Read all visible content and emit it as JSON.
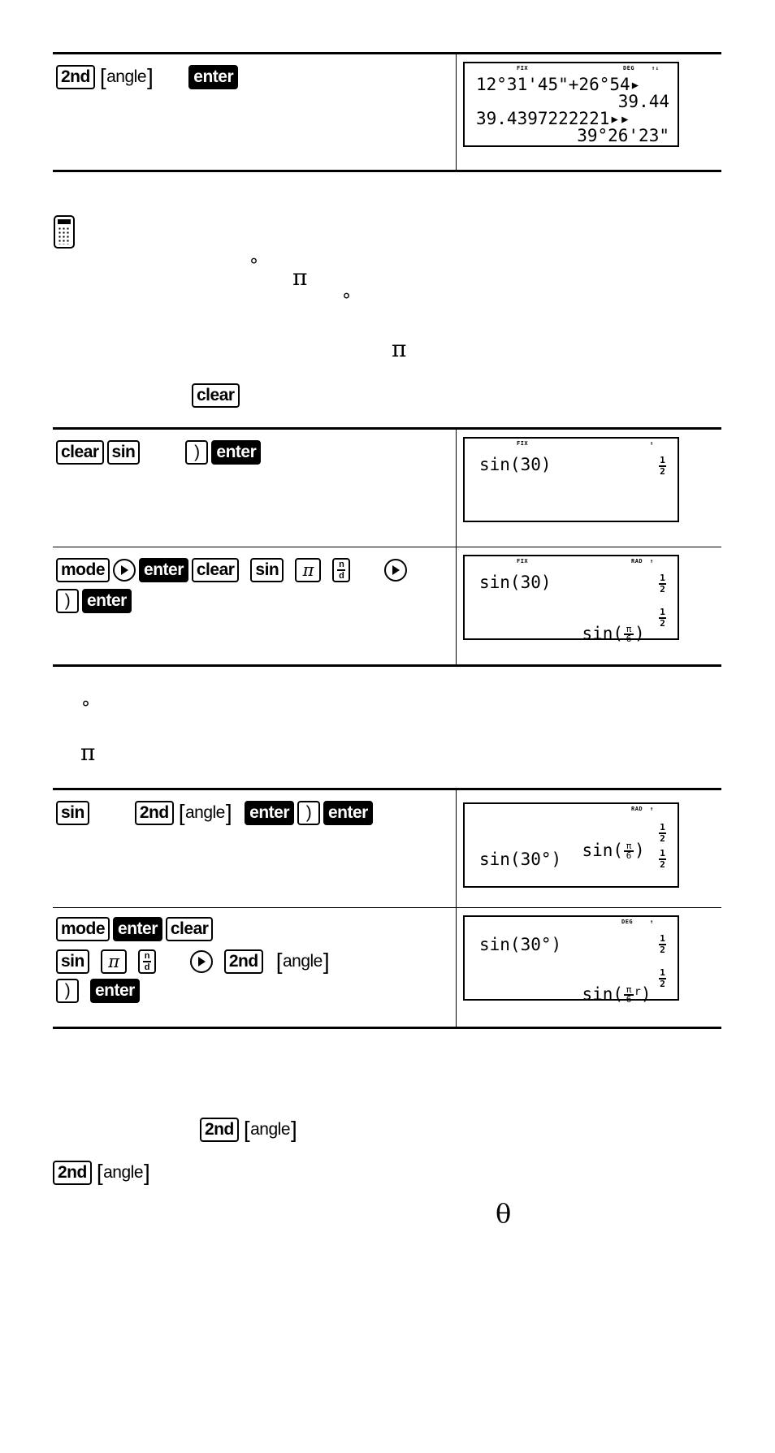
{
  "table1": {
    "row1": {
      "keys": [
        "2nd",
        "angle",
        "enter"
      ],
      "screen": {
        "indicators": {
          "left": "FIX",
          "mode": "DEG",
          "arrows": "↑↓"
        },
        "lines": [
          "12°31'45\"+26°54▸",
          "39.44",
          "39.4397222221▸▸",
          "39°26'23\""
        ]
      }
    }
  },
  "note_icon": "calculator-icon",
  "prose": {
    "degree1": "°",
    "pi1": "π",
    "degree2": "°",
    "pi2": "π",
    "clear_key": "clear"
  },
  "table2": {
    "row1": {
      "keys": [
        "clear",
        "sin",
        ")",
        "enter"
      ],
      "screen": {
        "indicators": {
          "left": "FIX",
          "arrows": "↑"
        },
        "lines": [
          "sin(30)"
        ],
        "results": [
          {
            "num": "1",
            "den": "2"
          }
        ]
      }
    },
    "row2": {
      "keys": [
        "mode",
        "right-arrow",
        "enter",
        "clear",
        "sin",
        "π",
        "n/d",
        "right-arrow",
        ")",
        "enter"
      ],
      "frac_key": {
        "num": "n",
        "den": "d"
      },
      "pi_key": "π",
      "screen": {
        "indicators": {
          "left": "FIX",
          "mode": "RAD",
          "arrows": "↑"
        },
        "lines": [
          "sin(30)",
          "sin("
        ],
        "frac": {
          "num": "π",
          "den": "6"
        },
        "close": ")",
        "results": [
          {
            "num": "1",
            "den": "2"
          },
          {
            "num": "1",
            "den": "2"
          }
        ]
      }
    }
  },
  "prose2": {
    "degree": "°",
    "pi": "π"
  },
  "table3": {
    "row1": {
      "keys": [
        "sin",
        "2nd",
        "angle",
        "enter",
        ")",
        "enter"
      ],
      "screen": {
        "indicators": {
          "mode": "RAD",
          "arrows": "↑"
        },
        "line1_prefix": "sin(",
        "frac": {
          "num": "π",
          "den": "6"
        },
        "line1_suffix": ")",
        "line2": "sin(30°)",
        "results": [
          {
            "num": "1",
            "den": "2"
          },
          {
            "num": "1",
            "den": "2"
          }
        ]
      }
    },
    "row2": {
      "keys": [
        "mode",
        "enter",
        "clear",
        "sin",
        "π",
        "n/d",
        "right-arrow",
        "2nd",
        "angle",
        ")",
        "enter"
      ],
      "frac_key": {
        "num": "n",
        "den": "d"
      },
      "pi_key": "π",
      "screen": {
        "indicators": {
          "mode": "DEG",
          "arrows": "↑"
        },
        "line1": "sin(30°)",
        "line2_prefix": "sin(",
        "frac": {
          "num": "π",
          "den": "6"
        },
        "radian_marker": "r",
        "line2_suffix": ")",
        "results": [
          {
            "num": "1",
            "den": "2"
          },
          {
            "num": "1",
            "den": "2"
          }
        ]
      }
    }
  },
  "footer": {
    "keys_a": [
      "2nd",
      "angle"
    ],
    "keys_b": [
      "2nd",
      "angle"
    ],
    "theta": "θ"
  }
}
